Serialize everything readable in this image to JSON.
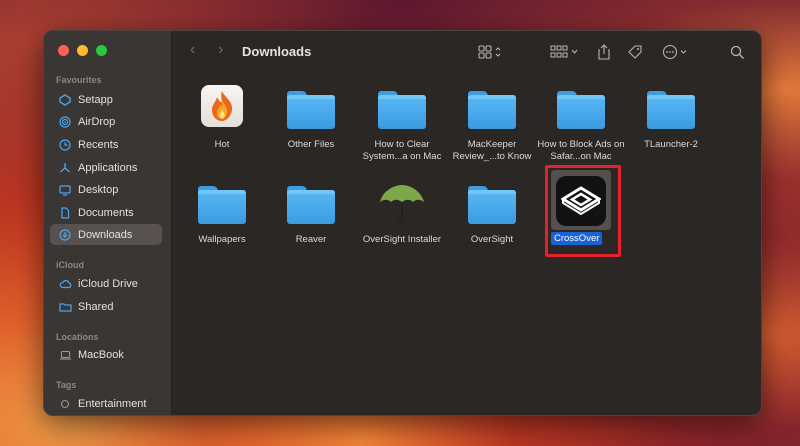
{
  "window": {
    "title": "Downloads"
  },
  "sidebar": {
    "sections": [
      {
        "label": "Favourites",
        "items": [
          {
            "label": "Setapp",
            "icon": "setapp-icon"
          },
          {
            "label": "AirDrop",
            "icon": "airdrop-icon"
          },
          {
            "label": "Recents",
            "icon": "clock-icon"
          },
          {
            "label": "Applications",
            "icon": "applications-icon"
          },
          {
            "label": "Desktop",
            "icon": "desktop-icon"
          },
          {
            "label": "Documents",
            "icon": "document-icon"
          },
          {
            "label": "Downloads",
            "icon": "download-icon",
            "selected": true
          }
        ]
      },
      {
        "label": "iCloud",
        "items": [
          {
            "label": "iCloud Drive",
            "icon": "cloud-icon"
          },
          {
            "label": "Shared",
            "icon": "shared-folder-icon"
          }
        ]
      },
      {
        "label": "Locations",
        "items": [
          {
            "label": "MacBook",
            "icon": "laptop-icon"
          }
        ]
      },
      {
        "label": "Tags",
        "items": [
          {
            "label": "Entertainment",
            "icon": "tag-circle-icon"
          }
        ]
      }
    ]
  },
  "files": [
    {
      "name": "Hot",
      "kind": "app",
      "icon": "hot-flame-icon"
    },
    {
      "name": "Other Files",
      "kind": "folder"
    },
    {
      "name": "How to Clear System...a on Mac",
      "kind": "folder"
    },
    {
      "name": "MacKeeper Review_...to Know",
      "kind": "folder"
    },
    {
      "name": "How to Block Ads on Safar...on Mac",
      "kind": "folder"
    },
    {
      "name": "TLauncher-2",
      "kind": "folder"
    },
    {
      "name": "Wallpapers",
      "kind": "folder"
    },
    {
      "name": "Reaver",
      "kind": "folder"
    },
    {
      "name": "OverSight Installer",
      "kind": "app",
      "icon": "umbrella-icon"
    },
    {
      "name": "OverSight",
      "kind": "folder"
    },
    {
      "name": "CrossOver",
      "kind": "app",
      "icon": "crossover-icon",
      "selected": true
    }
  ],
  "colors": {
    "highlight_box": "#e5202f",
    "selection": "#1a63d6",
    "folder": "#4aa8ec"
  }
}
